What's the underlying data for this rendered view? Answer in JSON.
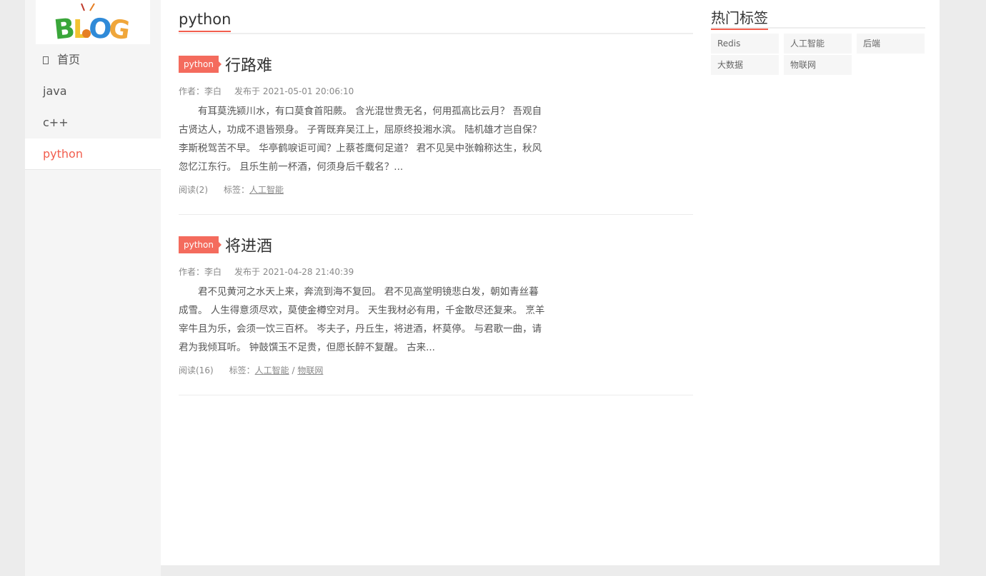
{
  "logo": {
    "text": "BLOG"
  },
  "nav": [
    {
      "label": "首页",
      "icon": "home-icon"
    },
    {
      "label": "java"
    },
    {
      "label": "c++"
    },
    {
      "label": "python",
      "active": true
    }
  ],
  "section": {
    "title": "python"
  },
  "articles": [
    {
      "category": "python",
      "title": "行路难",
      "author": "作者：李白",
      "published": "发布于 2021-05-01 20:06:10",
      "summary": "有耳莫洗颍川水，有口莫食首阳蕨。 含光混世贵无名，何用孤高比云月？ 吾观自古贤达人，功成不退皆殒身。 子胥既弃吴江上，屈原终投湘水滨。 陆机雄才岂自保？李斯税驾苦不早。 华亭鹤唳讵可闻？上蔡苍鹰何足道？ 君不见吴中张翰称达生，秋风忽忆江东行。 且乐生前一杯酒，何须身后千载名？...",
      "reads": "阅读(2)",
      "tags_label": "标签：",
      "tags": [
        "人工智能"
      ]
    },
    {
      "category": "python",
      "title": "将进酒",
      "author": "作者：李白",
      "published": "发布于 2021-04-28 21:40:39",
      "summary": "君不见黄河之水天上来，奔流到海不复回。 君不见高堂明镜悲白发，朝如青丝暮成雪。 人生得意须尽欢，莫使金樽空对月。 天生我材必有用，千金散尽还复来。 烹羊宰牛且为乐，会须一饮三百杯。 岑夫子，丹丘生，将进酒，杯莫停。 与君歌一曲，请君为我倾耳听。 钟鼓馔玉不足贵，但愿长醉不复醒。 古来...",
      "reads": "阅读(16)",
      "tags_label": "标签：",
      "tags": [
        "人工智能",
        "物联网"
      ],
      "tags_separator": " / "
    }
  ],
  "hot_tags": {
    "title": "热门标签",
    "items": [
      "Redis",
      "人工智能",
      "后端",
      "大数据",
      "物联网"
    ]
  },
  "colors": {
    "accent": "#f25e4e",
    "category_badge": "#f46b5d"
  }
}
